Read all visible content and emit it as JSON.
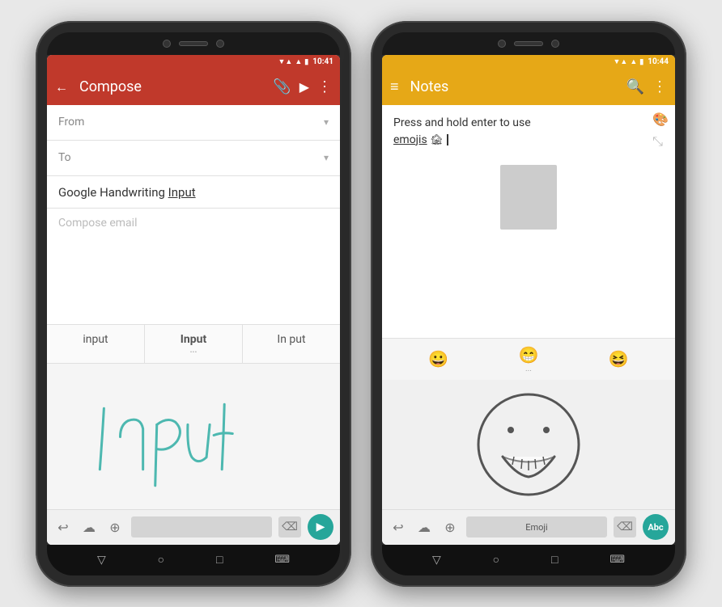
{
  "left_phone": {
    "status_bar": {
      "time": "10:41",
      "signal_icon": "▼▲",
      "wifi_icon": "▲",
      "battery_icon": "▮"
    },
    "toolbar": {
      "back_label": "←",
      "title": "Compose",
      "attach_icon": "📎",
      "send_icon": "▶",
      "more_icon": "⋮"
    },
    "from_field": {
      "label": "From",
      "has_chevron": true
    },
    "to_field": {
      "label": "To",
      "has_chevron": true
    },
    "subject": {
      "text": "Google Handwriting ",
      "underlined": "Input"
    },
    "compose_placeholder": "Compose email",
    "suggestions": [
      {
        "text": "input",
        "bold": false,
        "dots": ""
      },
      {
        "text": "Input",
        "bold": true,
        "dots": "..."
      },
      {
        "text": "In put",
        "bold": false,
        "dots": ""
      }
    ],
    "keyboard_bar": {
      "undo_icon": "↩",
      "cloud_icon": "☁",
      "globe_icon": "⊕",
      "delete_icon": "⌫",
      "send_icon": "▶"
    },
    "nav_bar": {
      "back": "▽",
      "home": "○",
      "recents": "□",
      "keyboard": "⌨"
    }
  },
  "right_phone": {
    "status_bar": {
      "time": "10:44"
    },
    "toolbar": {
      "menu_icon": "≡",
      "title": "Notes",
      "search_icon": "🔍",
      "more_icon": "⋮"
    },
    "note_text": "Press and hold enter to use",
    "note_text2": "emojis",
    "emoji_suggestions": [
      "😀",
      "😁",
      "😆"
    ],
    "keyboard_bar": {
      "undo_icon": "↩",
      "cloud_icon": "☁",
      "globe_icon": "⊕",
      "emoji_label": "Emoji",
      "delete_icon": "⌫",
      "abc_label": "Abc"
    },
    "nav_bar": {
      "back": "▽",
      "home": "○",
      "recents": "□",
      "keyboard": "⌨"
    }
  }
}
